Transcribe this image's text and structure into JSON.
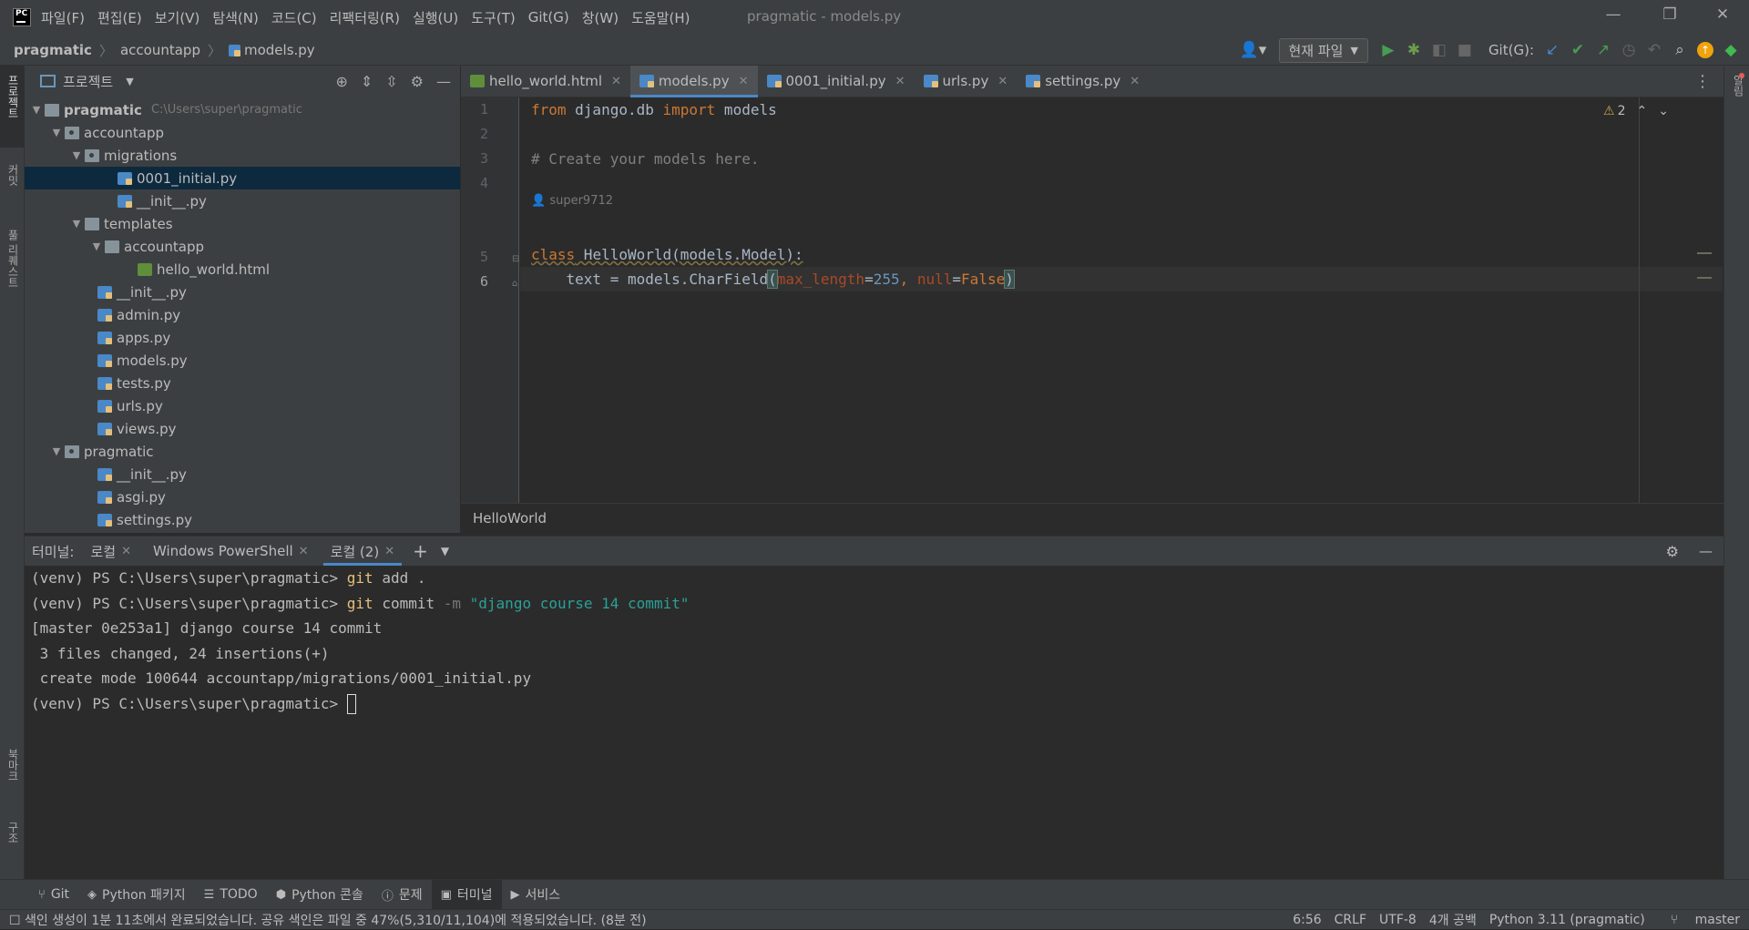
{
  "titlebar": {
    "menus": [
      "파일(F)",
      "편집(E)",
      "보기(V)",
      "탐색(N)",
      "코드(C)",
      "리팩터링(R)",
      "실행(U)",
      "도구(T)",
      "Git(G)",
      "창(W)",
      "도움말(H)"
    ],
    "title": "pragmatic - models.py",
    "minimize": "—",
    "restore": "❐",
    "close": "✕"
  },
  "navbar": {
    "crumbs": [
      "pragmatic",
      "accountapp",
      "models.py"
    ],
    "run_config": "현재 파일",
    "git_label": "Git(G):"
  },
  "left_strip": {
    "project": "프로젝트",
    "commit": "커밋",
    "pull_requests": "풀 리퀘스트",
    "bookmarks": "북마크",
    "structure": "구조"
  },
  "right_strip": {
    "notifications": "알림"
  },
  "project_panel": {
    "title": "프로젝트",
    "root_path": "C:\\Users\\super\\pragmatic",
    "items": [
      {
        "label": "pragmatic",
        "type": "root"
      },
      {
        "label": "accountapp",
        "type": "package"
      },
      {
        "label": "migrations",
        "type": "package"
      },
      {
        "label": "0001_initial.py",
        "type": "py"
      },
      {
        "label": "__init__.py",
        "type": "py"
      },
      {
        "label": "templates",
        "type": "folder"
      },
      {
        "label": "accountapp",
        "type": "folder"
      },
      {
        "label": "hello_world.html",
        "type": "html"
      },
      {
        "label": "__init__.py",
        "type": "py"
      },
      {
        "label": "admin.py",
        "type": "py"
      },
      {
        "label": "apps.py",
        "type": "py"
      },
      {
        "label": "models.py",
        "type": "py"
      },
      {
        "label": "tests.py",
        "type": "py"
      },
      {
        "label": "urls.py",
        "type": "py"
      },
      {
        "label": "views.py",
        "type": "py"
      },
      {
        "label": "pragmatic",
        "type": "package"
      },
      {
        "label": "__init__.py",
        "type": "py"
      },
      {
        "label": "asgi.py",
        "type": "py"
      },
      {
        "label": "settings.py",
        "type": "py"
      }
    ]
  },
  "editor": {
    "tabs": [
      "hello_world.html",
      "models.py",
      "0001_initial.py",
      "urls.py",
      "settings.py"
    ],
    "active_tab": "models.py",
    "line_numbers": [
      "1",
      "2",
      "3",
      "4",
      "5",
      "6"
    ],
    "code": {
      "line1_kw1": "from",
      "line1_mod": " django.db ",
      "line1_kw2": "import",
      "line1_name": " models",
      "line3_comment": "# Create your models here.",
      "author": "super9712",
      "line5_kw": "class",
      "line5_rest": " HelloWorld(models.Model):",
      "line6_a": "    text = models.CharField",
      "line6_open": "(",
      "line6_p1": "max_length",
      "line6_eq1": "=",
      "line6_n1": "255",
      "line6_comma": ", ",
      "line6_p2": "null",
      "line6_eq2": "=",
      "line6_v2": "False",
      "line6_close": ")"
    },
    "warning_count": "2",
    "breadcrumb": "HelloWorld"
  },
  "terminal": {
    "label": "터미널:",
    "tabs": [
      "로컬",
      "Windows PowerShell",
      "로컬 (2)"
    ],
    "active_tab": "로컬 (2)",
    "lines": {
      "l1_prompt": "(venv) PS C:\\Users\\super\\pragmatic> ",
      "l1_cmd": "git",
      "l1_rest": " add .",
      "l2_prompt": "(venv) PS C:\\Users\\super\\pragmatic> ",
      "l2_cmd": "git",
      "l2_sub": " commit ",
      "l2_flag": "-m",
      "l2_str": " \"django course 14 commit\"",
      "l3": "[master 0e253a1] django course 14 commit",
      "l4": " 3 files changed, 24 insertions(+)",
      "l5": " create mode 100644 accountapp/migrations/0001_initial.py",
      "l6_prompt": "(venv) PS C:\\Users\\super\\pragmatic> "
    }
  },
  "tool_windows": [
    "Git",
    "Python 패키지",
    "TODO",
    "Python 콘솔",
    "문제",
    "터미널",
    "서비스"
  ],
  "status_bar": {
    "message": "색인 생성이 1분 11초에서 완료되었습니다. 공유 색인은 파일 중 47%(5,310/11,104)에 적용되었습니다. (8분 전)",
    "position": "6:56",
    "line_sep": "CRLF",
    "encoding": "UTF-8",
    "indent": "4개 공백",
    "interpreter": "Python 3.11 (pragmatic)",
    "branch": "master"
  },
  "colors": {
    "accent": "#4a88c7",
    "keyword": "#cc7832",
    "comment": "#808080",
    "number": "#6897bb",
    "run_green": "#499c54"
  }
}
